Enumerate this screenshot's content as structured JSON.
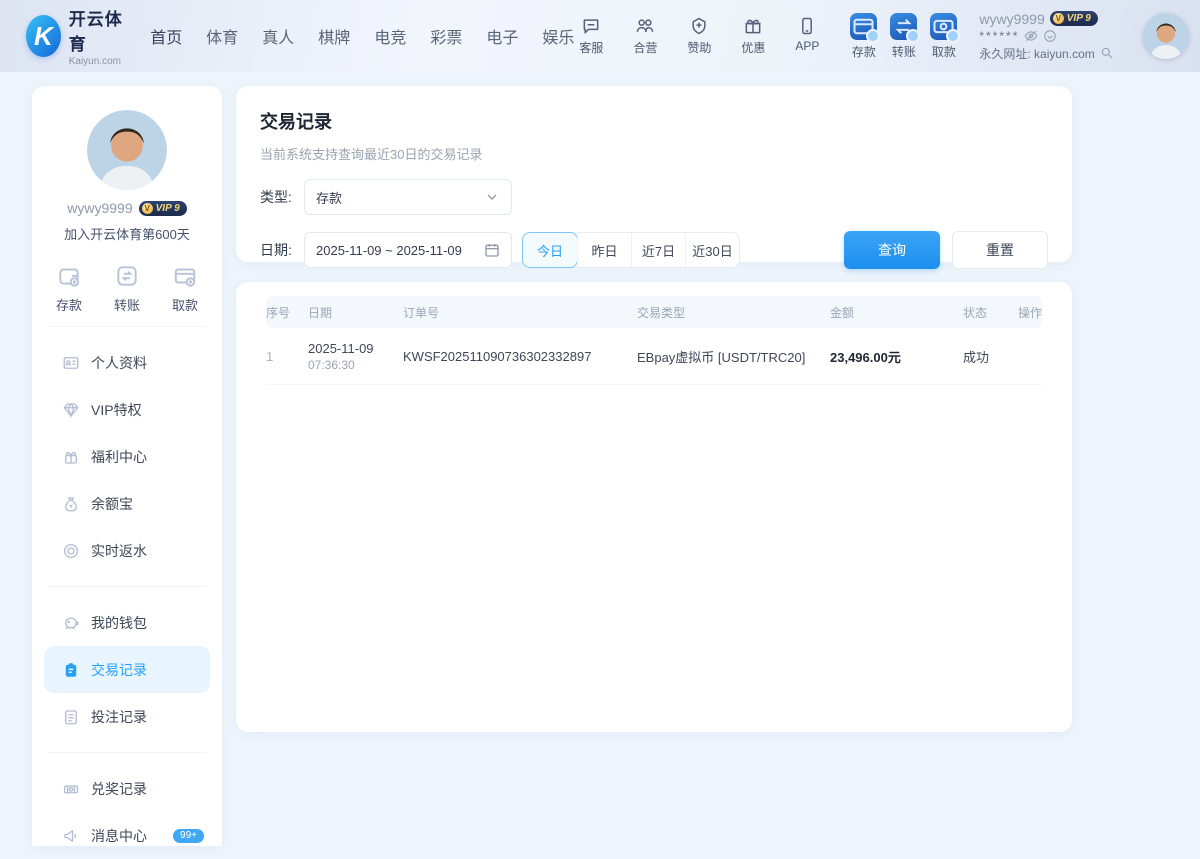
{
  "header": {
    "logo": {
      "mark": "K",
      "brand": "开云体育",
      "domain": "Kaiyun.com"
    },
    "nav": [
      "首页",
      "体育",
      "真人",
      "棋牌",
      "电竞",
      "彩票",
      "电子",
      "娱乐"
    ],
    "tools": [
      {
        "label": "客服",
        "icon": "chat"
      },
      {
        "label": "合营",
        "icon": "partners"
      },
      {
        "label": "赞助",
        "icon": "sponsor"
      },
      {
        "label": "优惠",
        "icon": "gift"
      },
      {
        "label": "APP",
        "icon": "phone"
      }
    ],
    "wallet_actions": [
      {
        "label": "存款",
        "icon": "deposit"
      },
      {
        "label": "转账",
        "icon": "transfer"
      },
      {
        "label": "取款",
        "icon": "withdraw"
      }
    ],
    "user": {
      "name": "wywy9999",
      "vip": "VIP 9",
      "password_mask": "******",
      "site_label": "永久网址: kaiyun.com"
    }
  },
  "sidebar": {
    "profile": {
      "name": "wywy9999",
      "vip": "VIP 9",
      "joined": "加入开云体育第600天"
    },
    "quick_actions": [
      {
        "label": "存款",
        "icon": "wallet"
      },
      {
        "label": "转账",
        "icon": "exchange"
      },
      {
        "label": "取款",
        "icon": "bank-card"
      }
    ],
    "groups": [
      {
        "items": [
          {
            "label": "个人资料",
            "icon": "id-card"
          },
          {
            "label": "VIP特权",
            "icon": "gem"
          },
          {
            "label": "福利中心",
            "icon": "welfare"
          },
          {
            "label": "余额宝",
            "icon": "money-bag"
          },
          {
            "label": "实时返水",
            "icon": "rebate"
          }
        ]
      },
      {
        "items": [
          {
            "label": "我的钱包",
            "icon": "piggy-bank"
          },
          {
            "label": "交易记录",
            "icon": "transaction",
            "active": true
          },
          {
            "label": "投注记录",
            "icon": "bet-record"
          }
        ]
      },
      {
        "items": [
          {
            "label": "兑奖记录",
            "icon": "prize"
          },
          {
            "label": "消息中心",
            "icon": "megaphone",
            "badge": "99+"
          }
        ]
      }
    ]
  },
  "filters": {
    "title": "交易记录",
    "subtitle": "当前系统支持查询最近30日的交易记录",
    "type_label": "类型:",
    "type_value": "存款",
    "date_label": "日期:",
    "date_value": "2025-11-09  ~  2025-11-09",
    "quick_ranges": [
      {
        "label": "今日",
        "active": true
      },
      {
        "label": "昨日",
        "active": false
      },
      {
        "label": "近7日",
        "active": false
      },
      {
        "label": "近30日",
        "active": false
      }
    ],
    "search_button": "查询",
    "reset_button": "重置"
  },
  "table": {
    "columns": [
      "序号",
      "日期",
      "订单号",
      "交易类型",
      "金额",
      "状态",
      "操作"
    ],
    "rows": [
      {
        "index": "1",
        "date": "2025-11-09",
        "time": "07:36:30",
        "order_no": "KWSF202511090736302332897",
        "type": "EBpay虚拟币 [USDT/TRC20]",
        "amount": "23,496.00元",
        "status": "成功",
        "action": ""
      }
    ]
  },
  "colors": {
    "accent": "#2196f3",
    "active_bg": "#e9f5fe",
    "page_bg": "#edf4fb",
    "amount_text": "#1f2633",
    "badge_bg": "#41a7f5"
  }
}
